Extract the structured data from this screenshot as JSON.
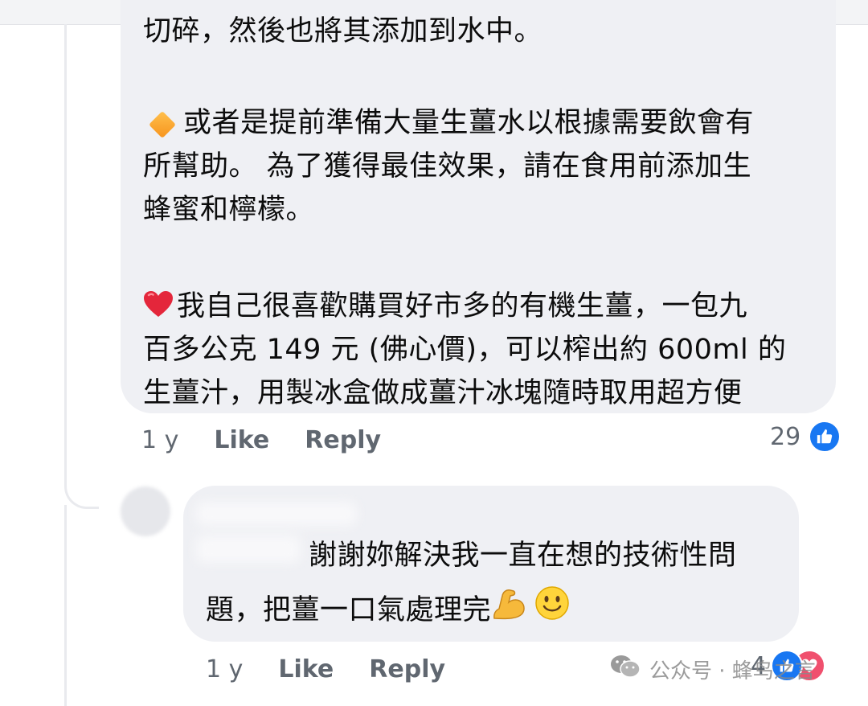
{
  "comment": {
    "paragraph_1": "切碎，然後也將其添加到水中。",
    "paragraph_2_icon": "orange-diamond-icon",
    "paragraph_2": "或者是提前準備大量生薑水以根據需要飲會有\n所幫助。 為了獲得最佳效果，請在食用前添加生\n蜂蜜和檸檬。",
    "paragraph_3_icon": "red-heart-icon",
    "paragraph_3": "我自己很喜歡購買好市多的有機生薑，一包九\n百多公克 149 元 (佛心價)，可以榨出約 600ml 的\n生薑汁，用製冰盒做成薑汁冰塊隨時取用超方便",
    "actions": {
      "time": "1 y",
      "like": "Like",
      "reply": "Reply"
    },
    "reaction_count": "29",
    "reaction_icon": "like-icon"
  },
  "reply": {
    "line_1": "謝謝妳解決我一直在想的技術性問",
    "line_2": "題，把薑一口氣處理完",
    "emojis": [
      "flexed-biceps-icon",
      "smiling-face-icon"
    ],
    "actions": {
      "time": "1 y",
      "like": "Like",
      "reply": "Reply"
    },
    "reaction_count": "4",
    "reaction_icons": [
      "like-icon",
      "heart-icon"
    ]
  },
  "watermark": {
    "icon": "wechat-icon",
    "text": "公众号 · 蜂鸟之言"
  },
  "colors": {
    "bubble": "#eff0f4",
    "text": "#0c0c0c",
    "meta": "#606770",
    "like_blue": "#1877f2",
    "heart_red": "#f0506e"
  }
}
